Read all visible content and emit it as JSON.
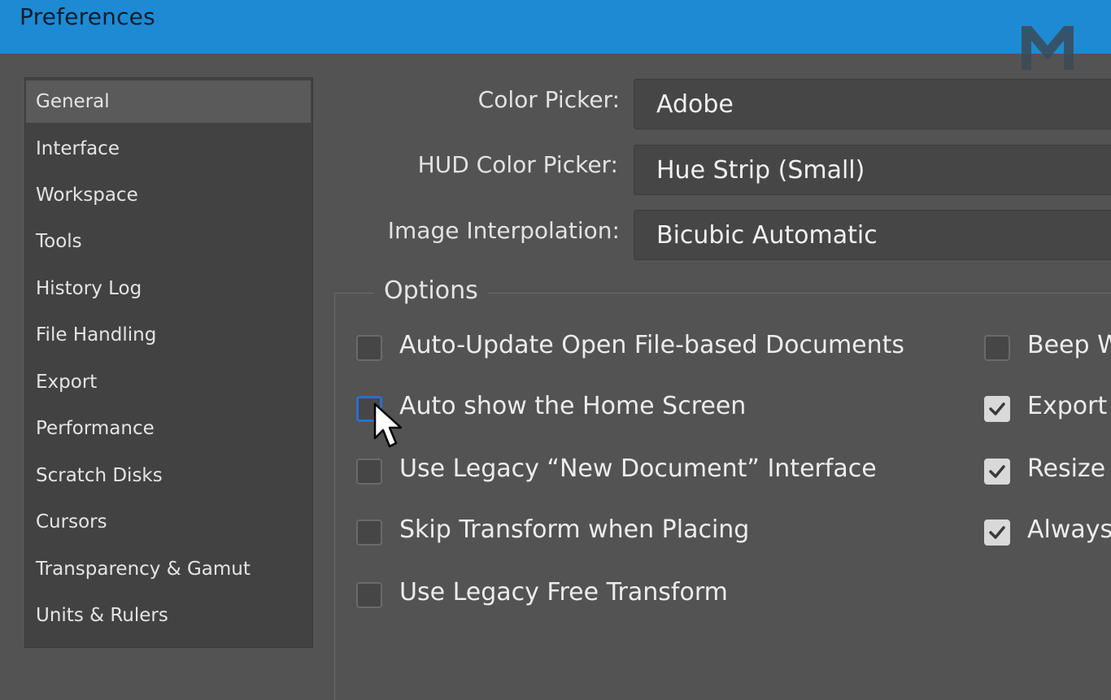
{
  "window": {
    "title": "Preferences"
  },
  "sidebar": {
    "items": [
      {
        "label": "General",
        "selected": true
      },
      {
        "label": "Interface"
      },
      {
        "label": "Workspace"
      },
      {
        "label": "Tools"
      },
      {
        "label": "History Log"
      },
      {
        "label": "File Handling"
      },
      {
        "label": "Export"
      },
      {
        "label": "Performance"
      },
      {
        "label": "Scratch Disks"
      },
      {
        "label": "Cursors"
      },
      {
        "label": "Transparency & Gamut"
      },
      {
        "label": "Units & Rulers"
      }
    ]
  },
  "settings": {
    "color_picker": {
      "label": "Color Picker:",
      "value": "Adobe"
    },
    "hud_color_picker": {
      "label": "HUD Color Picker:",
      "value": "Hue Strip (Small)"
    },
    "image_interpolation": {
      "label": "Image Interpolation:",
      "value": "Bicubic Automatic"
    }
  },
  "options": {
    "legend": "Options",
    "left": [
      {
        "label": "Auto-Update Open File-based Documents",
        "checked": false
      },
      {
        "label": "Auto show the Home Screen",
        "checked": false,
        "focused": true
      },
      {
        "label": "Use Legacy “New Document” Interface",
        "checked": false
      },
      {
        "label": "Skip Transform when Placing",
        "checked": false
      },
      {
        "label": "Use Legacy Free Transform",
        "checked": false
      }
    ],
    "right": [
      {
        "label": "Beep W",
        "checked": false
      },
      {
        "label": "Export",
        "checked": true
      },
      {
        "label": "Resize",
        "checked": true
      },
      {
        "label": "Always",
        "checked": true
      }
    ]
  },
  "colors": {
    "titlebar": "#1e8ad3",
    "panel": "#535353",
    "sidebar": "#424242",
    "selected_item": "#5a5a5a",
    "focus": "#2a6fcf"
  }
}
